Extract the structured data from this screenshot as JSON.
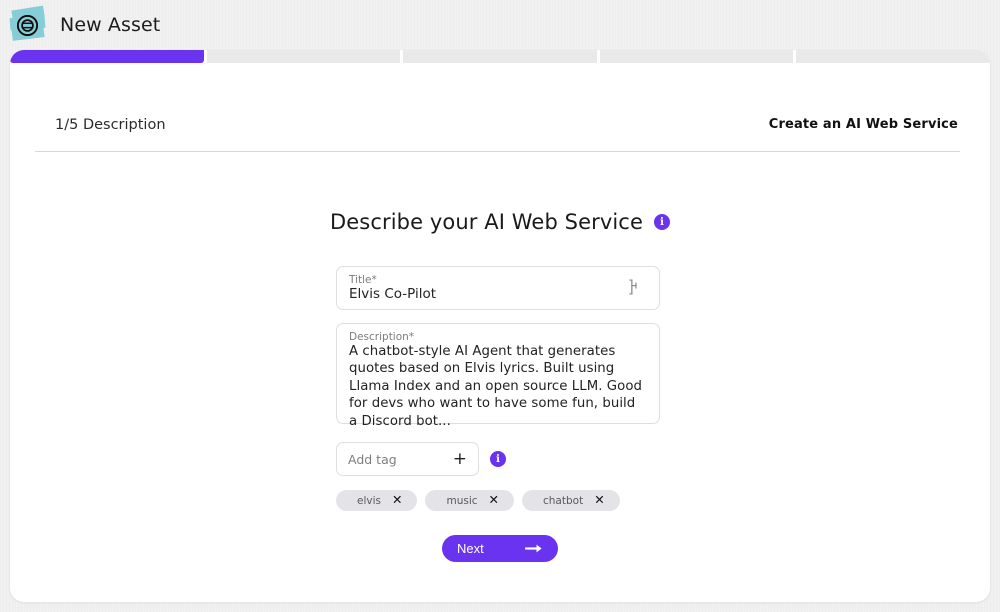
{
  "app": {
    "title": "New Asset",
    "logo_icon": "asset-logo-icon"
  },
  "wizard": {
    "total_steps": 5,
    "current_step": 1,
    "segments": [
      "done",
      "todo",
      "todo",
      "todo",
      "todo"
    ],
    "step_label": "1/5 Description",
    "flow_title": "Create an AI Web Service"
  },
  "main": {
    "headline": "Describe your AI Web Service",
    "headline_info_icon": "info-icon"
  },
  "form": {
    "title_field": {
      "label": "Title*",
      "value": "Elvis Co-Pilot",
      "cursor_icon": "text-ibeam-icon"
    },
    "description_field": {
      "label": "Description*",
      "value": "A chatbot-style AI Agent that generates quotes based on Elvis lyrics. Built using Llama Index and an open source LLM. Good for devs who want to have some fun, build a Discord bot..."
    },
    "tag_input": {
      "placeholder": "Add tag",
      "add_icon": "plus-icon",
      "info_icon": "info-icon"
    },
    "tags": [
      {
        "label": "elvis",
        "remove_icon": "close-icon"
      },
      {
        "label": "music",
        "remove_icon": "close-icon"
      },
      {
        "label": "chatbot",
        "remove_icon": "close-icon"
      }
    ]
  },
  "footer": {
    "next_label": "Next",
    "next_icon": "arrow-right-icon"
  },
  "colors": {
    "accent": "#6a33f0",
    "progress_track": "#e9e9e9",
    "chip_bg": "#e4e4e8",
    "page_bg": "#f2f2f2",
    "card_bg": "#ffffff",
    "logo_teal": "#86cdd8"
  }
}
